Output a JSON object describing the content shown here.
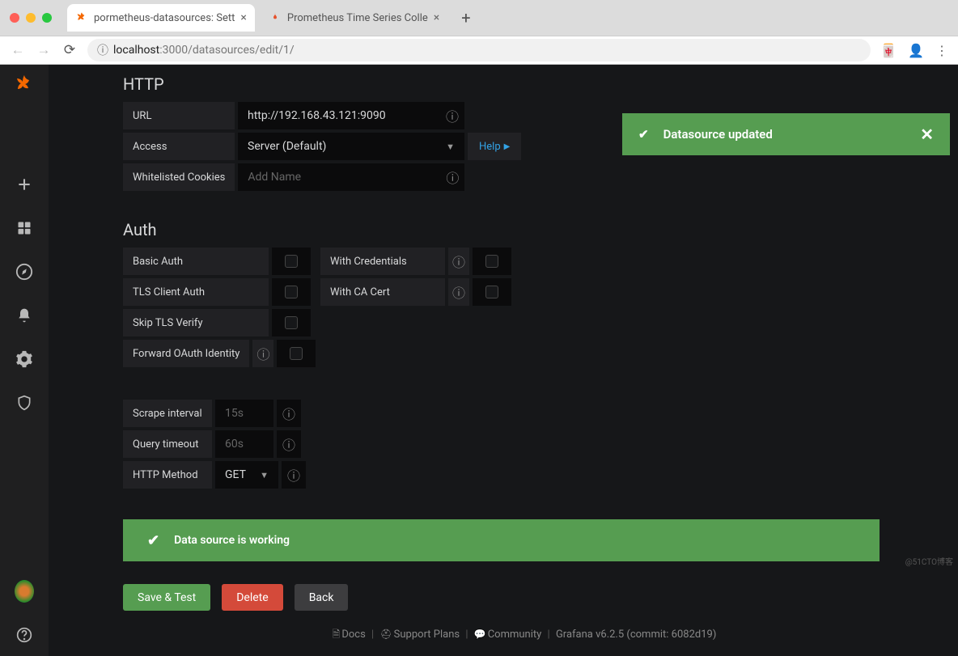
{
  "browser": {
    "tabs": [
      {
        "title": "pormetheus-datasources: Sett",
        "active": true
      },
      {
        "title": "Prometheus Time Series Colle",
        "active": false
      }
    ],
    "url_host": "localhost",
    "url_port_path": ":3000/datasources/edit/1/"
  },
  "toast": {
    "text": "Datasource updated"
  },
  "sections": {
    "http": "HTTP",
    "auth": "Auth"
  },
  "http": {
    "url_label": "URL",
    "url_value": "http://192.168.43.121:9090",
    "access_label": "Access",
    "access_value": "Server (Default)",
    "help": "Help",
    "cookies_label": "Whitelisted Cookies",
    "cookies_placeholder": "Add Name"
  },
  "auth": {
    "basic": "Basic Auth",
    "credentials": "With Credentials",
    "tls_client": "TLS Client Auth",
    "ca_cert": "With CA Cert",
    "skip_tls": "Skip TLS Verify",
    "forward_oauth": "Forward OAuth Identity"
  },
  "scrape": {
    "interval_label": "Scrape interval",
    "interval_placeholder": "15s",
    "timeout_label": "Query timeout",
    "timeout_placeholder": "60s",
    "method_label": "HTTP Method",
    "method_value": "GET"
  },
  "alert": {
    "text": "Data source is working"
  },
  "buttons": {
    "save": "Save & Test",
    "delete": "Delete",
    "back": "Back"
  },
  "footer": {
    "docs": "Docs",
    "support": "Support Plans",
    "community": "Community",
    "version": "Grafana v6.2.5 (commit: 6082d19)"
  },
  "watermark": "@51CTO博客"
}
